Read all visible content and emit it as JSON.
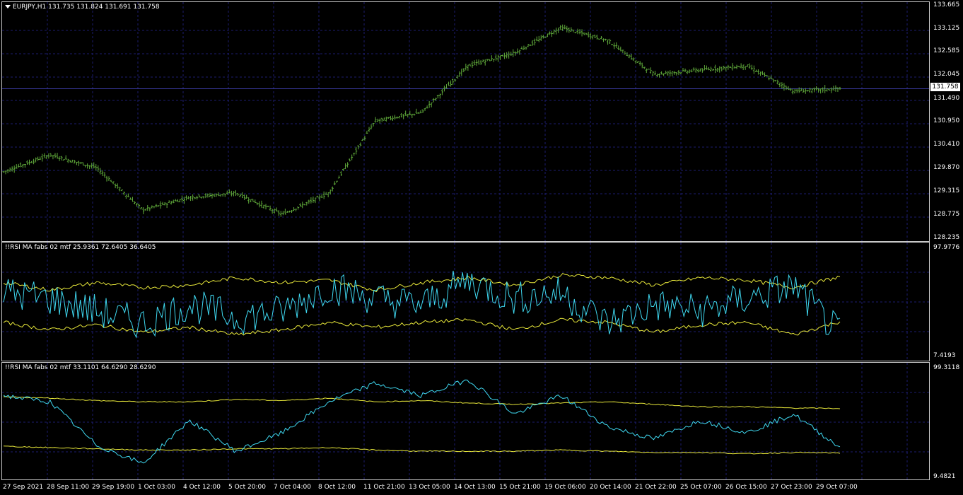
{
  "main": {
    "symbol_label": "EURJPY,H1  131.735 131.824 131.691 131.758",
    "axis_labels": [
      "133.665",
      "133.125",
      "132.585",
      "132.045",
      "131.490",
      "130.950",
      "130.410",
      "129.870",
      "129.315",
      "128.775",
      "128.235"
    ],
    "axis_min": 128.235,
    "axis_max": 133.665,
    "current_price": "131.758",
    "current_value": 131.758,
    "bar_color": "#5fa83a"
  },
  "rsi1": {
    "label": "!!RSI MA fabs 02 mtf 25.9361 72.6405 36.6405",
    "axis_top": "97.9776",
    "axis_bottom": "7.4193",
    "rsi_color": "#3fd8f0",
    "band_color": "#e8e83a"
  },
  "rsi2": {
    "label": "!!RSI MA fabs 02 mtf 33.1101 64.6290 28.6290",
    "axis_top": "99.3118",
    "axis_bottom": "9.4821",
    "rsi_color": "#3fd8f0",
    "band_color": "#e8e83a"
  },
  "time_axis": [
    "27 Sep 2021",
    "28 Sep 11:00",
    "29 Sep 19:00",
    "1 Oct 03:00",
    "4 Oct 12:00",
    "5 Oct 20:00",
    "7 Oct 04:00",
    "8 Oct 12:00",
    "11 Oct 21:00",
    "13 Oct 05:00",
    "14 Oct 13:00",
    "15 Oct 21:00",
    "19 Oct 06:00",
    "20 Oct 14:00",
    "21 Oct 22:00",
    "25 Oct 07:00",
    "26 Oct 15:00",
    "27 Oct 23:00",
    "29 Oct 07:00"
  ],
  "chart_data": [
    {
      "type": "line",
      "title": "EURJPY,H1",
      "x": [
        "27 Sep 2021",
        "28 Sep 11:00",
        "29 Sep 19:00",
        "1 Oct 03:00",
        "4 Oct 12:00",
        "5 Oct 20:00",
        "7 Oct 04:00",
        "8 Oct 12:00",
        "11 Oct 21:00",
        "13 Oct 05:00",
        "14 Oct 13:00",
        "15 Oct 21:00",
        "19 Oct 06:00",
        "20 Oct 14:00",
        "21 Oct 22:00",
        "25 Oct 07:00",
        "26 Oct 15:00",
        "27 Oct 23:00",
        "29 Oct 07:00"
      ],
      "series": [
        {
          "name": "EURJPY",
          "values": [
            129.8,
            130.2,
            129.9,
            128.9,
            129.2,
            129.3,
            128.8,
            129.3,
            131.0,
            131.2,
            132.3,
            132.6,
            133.2,
            132.9,
            132.1,
            132.2,
            132.3,
            131.7,
            131.758
          ]
        }
      ],
      "ylim": [
        128.235,
        133.665
      ]
    },
    {
      "type": "line",
      "title": "!!RSI MA fabs 02 mtf 25.9361 72.6405 36.6405",
      "x": [
        "27 Sep 2021",
        "28 Sep 11:00",
        "29 Sep 19:00",
        "1 Oct 03:00",
        "4 Oct 12:00",
        "5 Oct 20:00",
        "7 Oct 04:00",
        "8 Oct 12:00",
        "11 Oct 21:00",
        "13 Oct 05:00",
        "14 Oct 13:00",
        "15 Oct 21:00",
        "19 Oct 06:00",
        "20 Oct 14:00",
        "21 Oct 22:00",
        "25 Oct 07:00",
        "26 Oct 15:00",
        "27 Oct 23:00",
        "29 Oct 07:00"
      ],
      "series": [
        {
          "values": [
            60,
            55,
            45,
            35,
            50,
            40,
            45,
            65,
            55,
            50,
            70,
            55,
            60,
            35,
            50,
            45,
            55,
            65,
            25.9361
          ]
        },
        {
          "values": [
            68,
            62,
            68,
            64,
            66,
            72,
            68,
            70,
            62,
            68,
            72,
            66,
            74,
            72,
            66,
            72,
            70,
            64,
            72.6405
          ]
        },
        {
          "values": [
            36,
            30,
            34,
            28,
            32,
            26,
            30,
            36,
            32,
            36,
            38,
            30,
            38,
            36,
            28,
            34,
            36,
            26,
            36.6405
          ]
        }
      ],
      "ylim": [
        7.4193,
        97.9776
      ]
    },
    {
      "type": "line",
      "title": "!!RSI MA fabs 02 mtf 33.1101 64.6290 28.6290",
      "x": [
        "27 Sep 2021",
        "28 Sep 11:00",
        "29 Sep 19:00",
        "1 Oct 03:00",
        "4 Oct 12:00",
        "5 Oct 20:00",
        "7 Oct 04:00",
        "8 Oct 12:00",
        "11 Oct 21:00",
        "13 Oct 05:00",
        "14 Oct 13:00",
        "15 Oct 21:00",
        "19 Oct 06:00",
        "20 Oct 14:00",
        "21 Oct 22:00",
        "25 Oct 07:00",
        "26 Oct 15:00",
        "27 Oct 23:00",
        "29 Oct 07:00"
      ],
      "series": [
        {
          "values": [
            75,
            70,
            35,
            20,
            55,
            30,
            45,
            70,
            85,
            75,
            88,
            60,
            75,
            50,
            40,
            55,
            45,
            60,
            33.1101
          ]
        },
        {
          "values": [
            74,
            73,
            71,
            70,
            70,
            72,
            71,
            73,
            70,
            71,
            69,
            68,
            69,
            70,
            68,
            66,
            66,
            65,
            64.629
          ]
        },
        {
          "values": [
            34,
            33,
            32,
            31,
            31,
            32,
            32,
            33,
            31,
            30,
            30,
            30,
            31,
            30,
            29,
            29,
            28,
            29,
            28.629
          ]
        }
      ],
      "ylim": [
        9.4821,
        99.3118
      ]
    }
  ]
}
